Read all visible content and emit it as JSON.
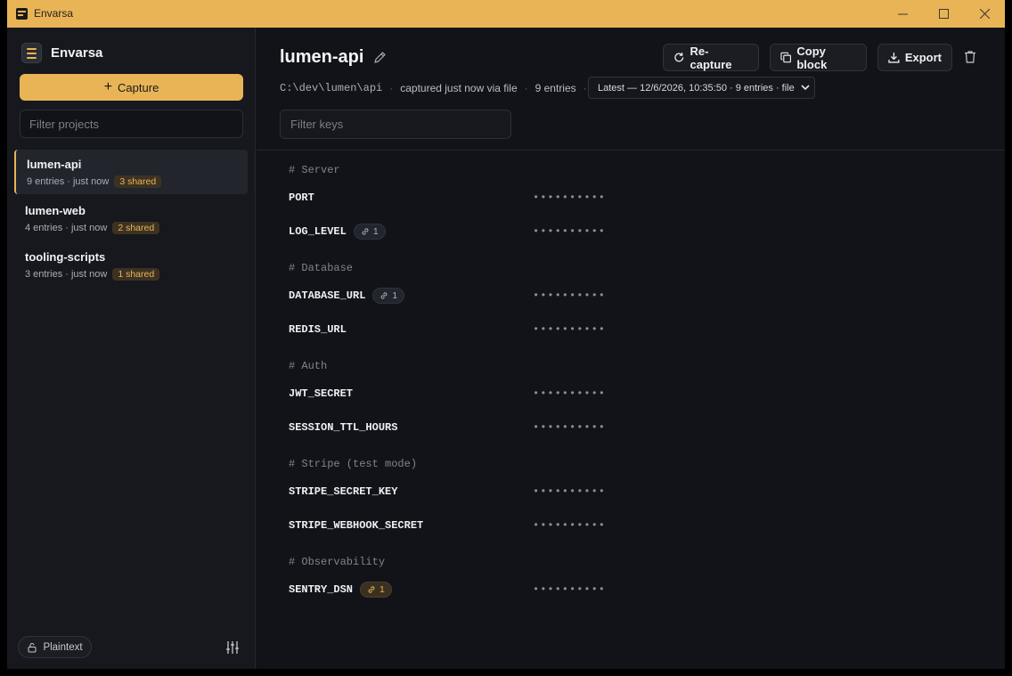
{
  "window": {
    "title": "Envarsa"
  },
  "sidebar": {
    "brand": "Envarsa",
    "capture_label": "Capture",
    "filter_placeholder": "Filter projects",
    "projects": [
      {
        "name": "lumen-api",
        "meta": "9 entries · just now",
        "shared": "3 shared"
      },
      {
        "name": "lumen-web",
        "meta": "4 entries · just now",
        "shared": "2 shared"
      },
      {
        "name": "tooling-scripts",
        "meta": "3 entries · just now",
        "shared": "1 shared"
      }
    ],
    "plaintext_label": "Plaintext"
  },
  "main": {
    "title": "lumen-api",
    "toolbar": {
      "recapture": "Re-capture",
      "copy_block": "Copy block",
      "export": "Export"
    },
    "meta": {
      "path": "C:\\dev\\lumen\\api",
      "captured": "captured just now via file",
      "entries": "9 entries"
    },
    "snapshot": "Latest — 12/6/2026, 10:35:50 · 9 entries · file",
    "filter_placeholder": "Filter keys",
    "masked_value": "••••••••••",
    "sections": [
      {
        "label": "# Server",
        "entries": [
          {
            "key": "PORT",
            "link": ""
          },
          {
            "key": "LOG_LEVEL",
            "link": "1"
          }
        ]
      },
      {
        "label": "# Database",
        "entries": [
          {
            "key": "DATABASE_URL",
            "link": "1"
          },
          {
            "key": "REDIS_URL",
            "link": ""
          }
        ]
      },
      {
        "label": "# Auth",
        "entries": [
          {
            "key": "JWT_SECRET",
            "link": ""
          },
          {
            "key": "SESSION_TTL_HOURS",
            "link": ""
          }
        ]
      },
      {
        "label": "# Stripe (test mode)",
        "entries": [
          {
            "key": "STRIPE_SECRET_KEY",
            "link": ""
          },
          {
            "key": "STRIPE_WEBHOOK_SECRET",
            "link": ""
          }
        ]
      },
      {
        "label": "# Observability",
        "entries": [
          {
            "key": "SENTRY_DSN",
            "link": "1"
          }
        ]
      }
    ]
  },
  "colors": {
    "accent": "#e8b456",
    "background": "#111318",
    "sidebar": "#16181d"
  }
}
